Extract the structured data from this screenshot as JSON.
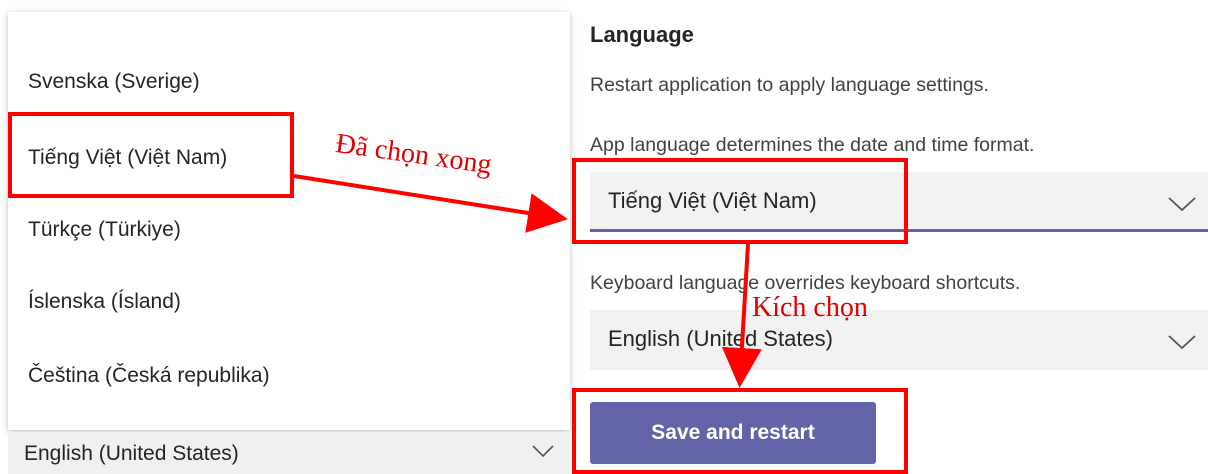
{
  "language_list": {
    "items": [
      {
        "label": "Svenska (Sverige)"
      },
      {
        "label": "Tiếng Việt (Việt Nam)"
      },
      {
        "label": "Türkçe (Türkiye)"
      },
      {
        "label": "Íslenska (Ísland)"
      },
      {
        "label": "Čeština (Česká republika)"
      }
    ]
  },
  "bottom_select": {
    "value": "English (United States)",
    "icon": "chevron-down-icon"
  },
  "language_section": {
    "title": "Language",
    "restart_note": "Restart application to apply language settings.",
    "app_language_desc": "App language determines the date and time format.",
    "app_language_value": "Tiếng Việt (Việt Nam)",
    "keyboard_language_desc": "Keyboard language overrides keyboard shortcuts.",
    "keyboard_language_value": "English (United States)",
    "save_button_label": "Save and restart"
  },
  "annotations": {
    "selected_label": "Đã chọn xong",
    "click_label": "Kích chọn",
    "color": "#ff0000"
  },
  "colors": {
    "accent": "#6264a7"
  }
}
